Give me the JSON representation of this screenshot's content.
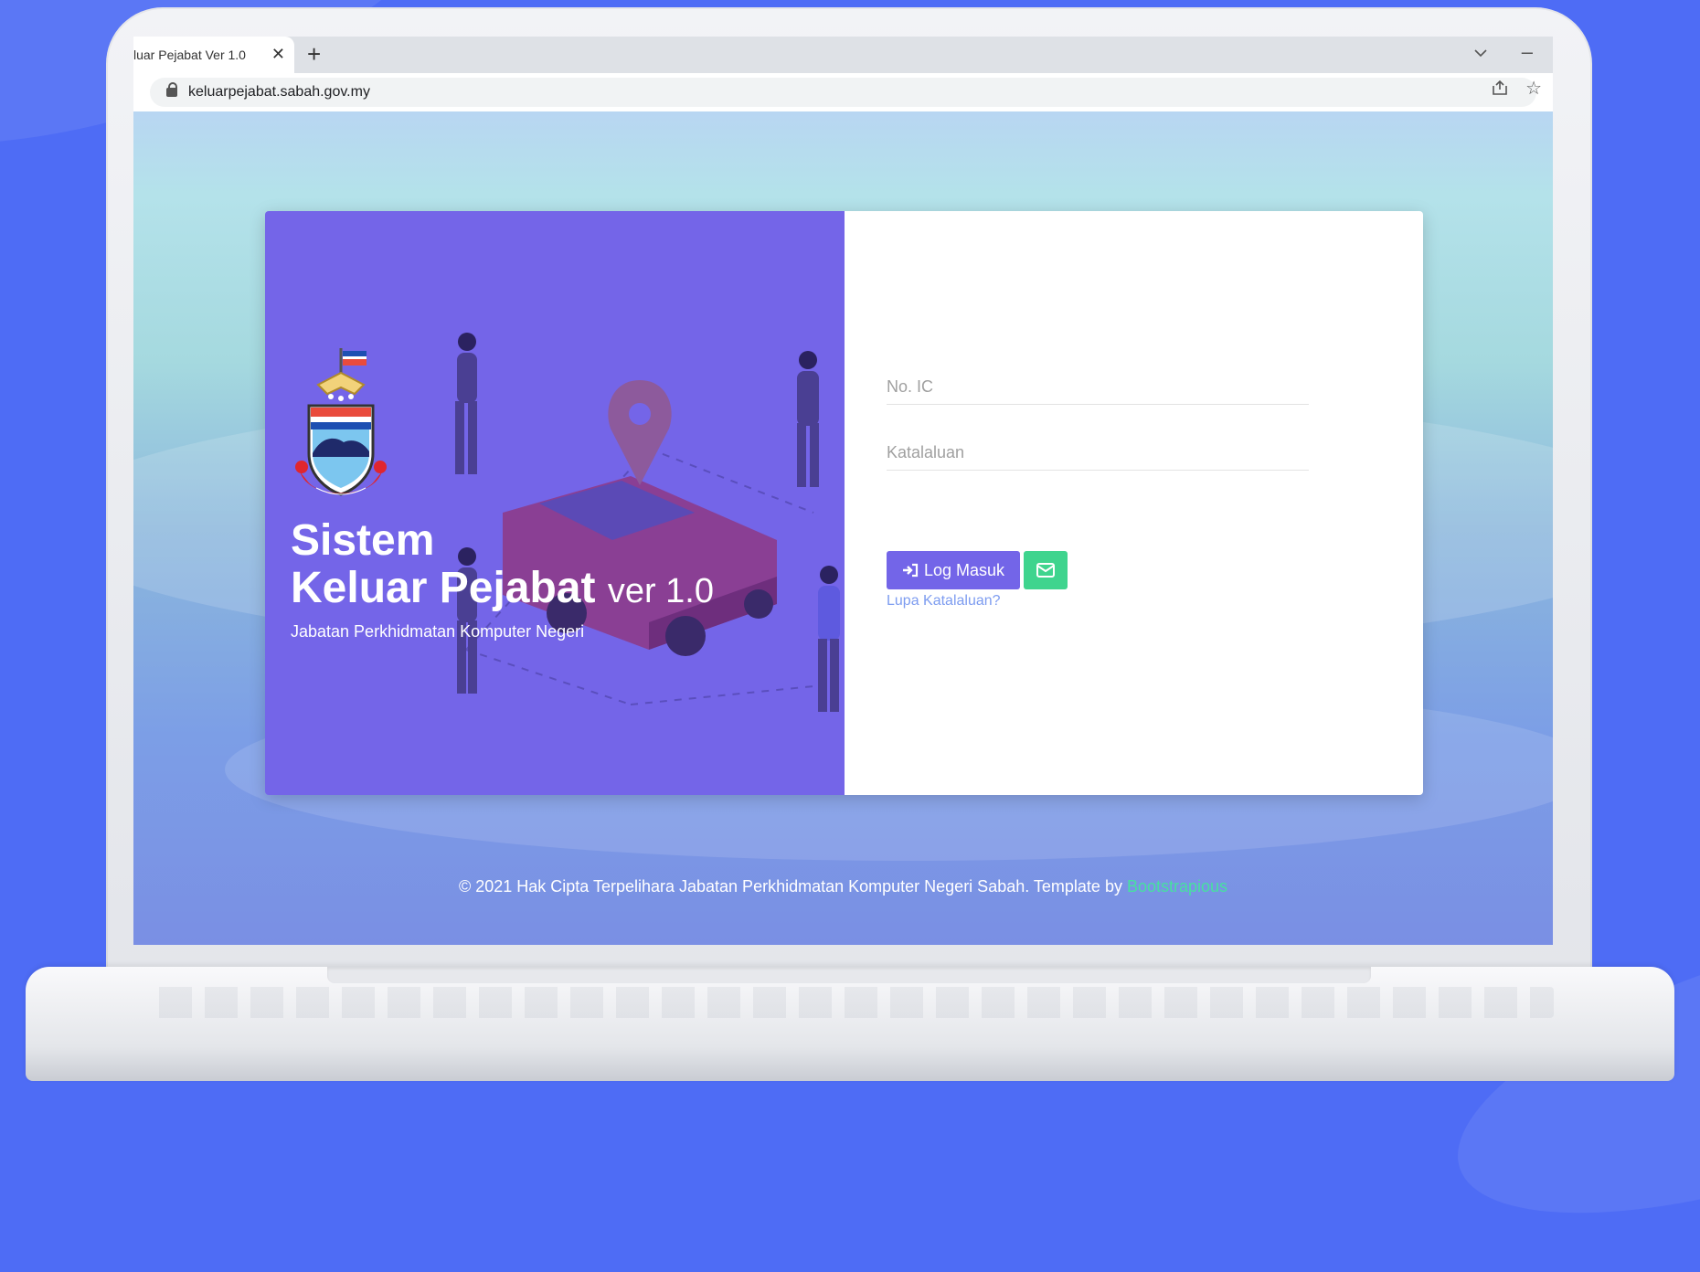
{
  "browser": {
    "tab_title": "luar Pejabat Ver 1.0",
    "tab_close": "✕",
    "new_tab": "+",
    "url": "keluarpejabat.sabah.gov.my"
  },
  "brand": {
    "title_line1": "Sistem",
    "title_line2": "Keluar Pejabat",
    "version": "ver 1.0",
    "subtitle": "Jabatan Perkhidmatan Komputer Negeri",
    "emblem_motto": "SABAH MAJU JAYA"
  },
  "login_form": {
    "ic_placeholder": "No. IC",
    "password_placeholder": "Katalaluan",
    "login_label": "Log Masuk",
    "forgot_label": "Lupa Katalaluan?"
  },
  "footer": {
    "text": "© 2021 Hak Cipta Terpelihara Jabatan Perkhidmatan Komputer Negeri Sabah. Template by",
    "link": "Bootstrapious"
  },
  "colors": {
    "background": "#4e6cf5",
    "card_left": "#7465e8",
    "primary_button": "#7365e8",
    "mail_button": "#3fd48e",
    "link": "#7d9cf0"
  },
  "icons": {
    "login": "sign-in-icon",
    "mail": "envelope-icon",
    "lock": "lock-icon",
    "share": "share-icon",
    "star": "bookmark-star-icon"
  }
}
